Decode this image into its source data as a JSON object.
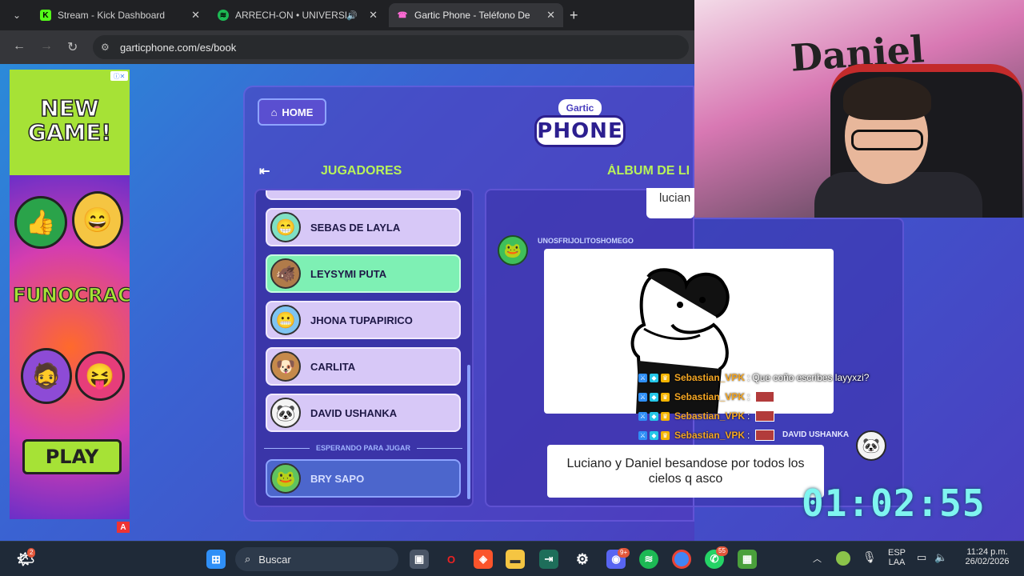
{
  "browser": {
    "tabs": [
      {
        "title": "Stream - Kick Dashboard",
        "icon": "kick-icon",
        "color": "#53fc18"
      },
      {
        "title": "ARRECH-ON • UNIVERSE, Y",
        "icon": "spotify-icon",
        "color": "#1db954"
      },
      {
        "title": "Gartic Phone - Teléfono De",
        "icon": "gartic-icon",
        "color": "#ff6ad5"
      }
    ],
    "url": "garticphone.com/es/book"
  },
  "ad": {
    "headline": "NEW GAME!",
    "brand": "FUNOCRACY",
    "cta": "PLAY",
    "badge": "A"
  },
  "game": {
    "home_label": "HOME",
    "logo_top": "Gartic",
    "logo_main": "PHONE",
    "players_title": "JUGADORES",
    "album_title": "ÁLBUM DE LI",
    "players": [
      {
        "name": "SEBAS DE LAYLA",
        "avatar": "😁",
        "color": "#7fe0c4",
        "highlight": false
      },
      {
        "name": "LEYSYMI PUTA",
        "avatar": "🐗",
        "color": "#b07b4a",
        "highlight": true
      },
      {
        "name": "JHONA TUPAPIRICO",
        "avatar": "😬",
        "color": "#7ec4f2",
        "highlight": false
      },
      {
        "name": "CARLITA",
        "avatar": "🐶",
        "color": "#c58a4b",
        "highlight": false
      },
      {
        "name": "DAVID USHANKA",
        "avatar": "🐼",
        "color": "#f4f4f4",
        "highlight": false
      }
    ],
    "waiting_label": "ESPERANDO PARA JUGAR",
    "waiting_player": {
      "name": "BRY SAPO",
      "avatar": "🐸",
      "color": "#5fc35f"
    },
    "album": {
      "top_bubble": "lucian",
      "drawer": "UNOSFRIJOLITOSHOMEGO",
      "answer": "Luciano y Daniel besandose por todos los cielos q asco",
      "answer_author": "DAVID USHANKA"
    }
  },
  "chat": [
    {
      "user": "Sebastian_VPK",
      "message": "Que coño escribes layyxzi?"
    },
    {
      "user": "Sebastian_VPK",
      "message": ""
    },
    {
      "user": "Sebastian_VPK",
      "message": ""
    },
    {
      "user": "Sebastian_VPK",
      "message": ""
    }
  ],
  "timer": "01:02:55",
  "webcam": {
    "wall_tag": "Daniel"
  },
  "taskbar": {
    "search_placeholder": "Buscar",
    "weather_badge": "2",
    "discord_badge": "9+",
    "whatsapp_badge": "55",
    "lang_top": "ESP",
    "lang_bottom": "LAA",
    "time": "11:24 p.m.",
    "date": "26/02/2026"
  }
}
